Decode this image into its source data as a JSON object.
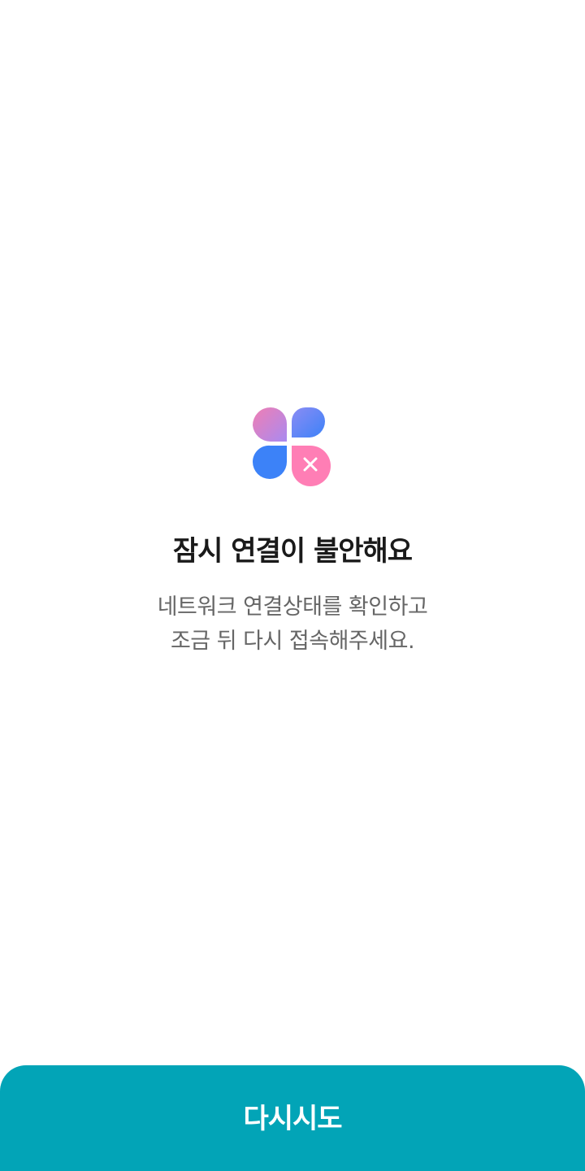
{
  "error": {
    "title": "잠시 연결이 불안해요",
    "message_line1": "네트워크 연결상태를 확인하고",
    "message_line2": "조금 뒤 다시 접속해주세요."
  },
  "actions": {
    "retry_label": "다시시도"
  },
  "logo": {
    "icon": "clover-error-icon",
    "colors": {
      "pink": "#f07eb3",
      "purple": "#a98af0",
      "blue": "#3c82f8",
      "error_pink": "#ff7eb5"
    }
  },
  "colors": {
    "button": "#02a4b7",
    "title": "#1a1a1a",
    "message": "#666666"
  }
}
